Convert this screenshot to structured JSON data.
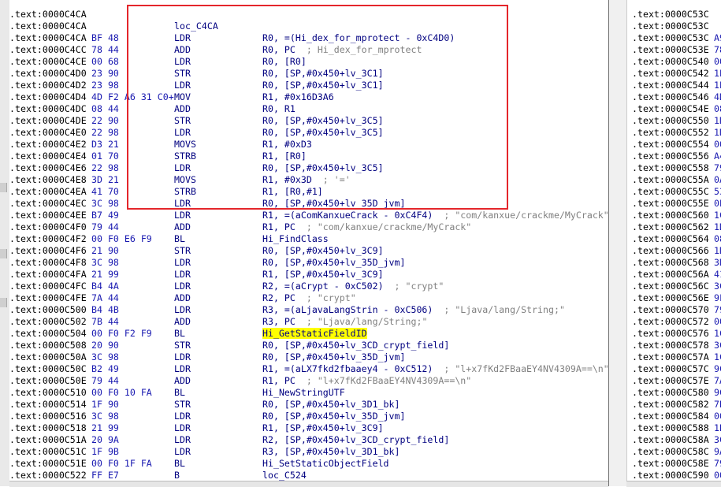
{
  "left_listing": [
    {
      "addr": ".text:0000C4CA",
      "bytes": "",
      "label": "",
      "mnem": "",
      "ops": "",
      "cmt": ""
    },
    {
      "addr": ".text:0000C4CA",
      "bytes": "",
      "label": "loc_C4CA",
      "mnem": "",
      "ops": "",
      "cmt": ""
    },
    {
      "addr": ".text:0000C4CA",
      "bytes": "BF 48",
      "label": "",
      "mnem": "LDR",
      "ops": "R0, =(Hi_dex_for_mprotect - 0xC4D0)",
      "cmt": ""
    },
    {
      "addr": ".text:0000C4CC",
      "bytes": "78 44",
      "label": "",
      "mnem": "ADD",
      "ops": "R0, PC",
      "cmt": "; Hi_dex_for_mprotect"
    },
    {
      "addr": ".text:0000C4CE",
      "bytes": "00 68",
      "label": "",
      "mnem": "LDR",
      "ops": "R0, [R0]",
      "cmt": ""
    },
    {
      "addr": ".text:0000C4D0",
      "bytes": "23 90",
      "label": "",
      "mnem": "STR",
      "ops": "R0, [SP,#0x450+lv_3C1]",
      "cmt": ""
    },
    {
      "addr": ".text:0000C4D2",
      "bytes": "23 98",
      "label": "",
      "mnem": "LDR",
      "ops": "R0, [SP,#0x450+lv_3C1]",
      "cmt": ""
    },
    {
      "addr": ".text:0000C4D4",
      "bytes": "4D F2 A6 31 C0+",
      "label": "",
      "mnem": "MOV",
      "ops": "R1, #0x16D3A6",
      "cmt": ""
    },
    {
      "addr": ".text:0000C4DC",
      "bytes": "08 44",
      "label": "",
      "mnem": "ADD",
      "ops": "R0, R1",
      "cmt": ""
    },
    {
      "addr": ".text:0000C4DE",
      "bytes": "22 90",
      "label": "",
      "mnem": "STR",
      "ops": "R0, [SP,#0x450+lv_3C5]",
      "cmt": ""
    },
    {
      "addr": ".text:0000C4E0",
      "bytes": "22 98",
      "label": "",
      "mnem": "LDR",
      "ops": "R0, [SP,#0x450+lv_3C5]",
      "cmt": ""
    },
    {
      "addr": ".text:0000C4E2",
      "bytes": "D3 21",
      "label": "",
      "mnem": "MOVS",
      "ops": "R1, #0xD3",
      "cmt": ""
    },
    {
      "addr": ".text:0000C4E4",
      "bytes": "01 70",
      "label": "",
      "mnem": "STRB",
      "ops": "R1, [R0]",
      "cmt": ""
    },
    {
      "addr": ".text:0000C4E6",
      "bytes": "22 98",
      "label": "",
      "mnem": "LDR",
      "ops": "R0, [SP,#0x450+lv_3C5]",
      "cmt": ""
    },
    {
      "addr": ".text:0000C4E8",
      "bytes": "3D 21",
      "label": "",
      "mnem": "MOVS",
      "ops": "R1, #0x3D",
      "cmt": "; '='"
    },
    {
      "addr": ".text:0000C4EA",
      "bytes": "41 70",
      "label": "",
      "mnem": "STRB",
      "ops": "R1, [R0,#1]",
      "cmt": ""
    },
    {
      "addr": ".text:0000C4EC",
      "bytes": "3C 98",
      "label": "",
      "mnem": "LDR",
      "ops": "R0, [SP,#0x450+lv_35D_jvm]",
      "cmt": ""
    },
    {
      "addr": ".text:0000C4EE",
      "bytes": "B7 49",
      "label": "",
      "mnem": "LDR",
      "ops": "R1, =(aComKanxueCrack - 0xC4F4)",
      "cmt": "; \"com/kanxue/crackme/MyCrack\""
    },
    {
      "addr": ".text:0000C4F0",
      "bytes": "79 44",
      "label": "",
      "mnem": "ADD",
      "ops": "R1, PC",
      "cmt": "; \"com/kanxue/crackme/MyCrack\""
    },
    {
      "addr": ".text:0000C4F2",
      "bytes": "00 F0 E6 F9",
      "label": "",
      "mnem": "BL",
      "ops": "Hi_FindClass",
      "cmt": ""
    },
    {
      "addr": ".text:0000C4F6",
      "bytes": "21 90",
      "label": "",
      "mnem": "STR",
      "ops": "R0, [SP,#0x450+lv_3C9]",
      "cmt": ""
    },
    {
      "addr": ".text:0000C4F8",
      "bytes": "3C 98",
      "label": "",
      "mnem": "LDR",
      "ops": "R0, [SP,#0x450+lv_35D_jvm]",
      "cmt": ""
    },
    {
      "addr": ".text:0000C4FA",
      "bytes": "21 99",
      "label": "",
      "mnem": "LDR",
      "ops": "R1, [SP,#0x450+lv_3C9]",
      "cmt": ""
    },
    {
      "addr": ".text:0000C4FC",
      "bytes": "B4 4A",
      "label": "",
      "mnem": "LDR",
      "ops": "R2, =(aCrypt - 0xC502)",
      "cmt": "; \"crypt\""
    },
    {
      "addr": ".text:0000C4FE",
      "bytes": "7A 44",
      "label": "",
      "mnem": "ADD",
      "ops": "R2, PC",
      "cmt": "; \"crypt\""
    },
    {
      "addr": ".text:0000C500",
      "bytes": "B4 4B",
      "label": "",
      "mnem": "LDR",
      "ops": "R3, =(aLjavaLangStrin - 0xC506)",
      "cmt": "; \"Ljava/lang/String;\""
    },
    {
      "addr": ".text:0000C502",
      "bytes": "7B 44",
      "label": "",
      "mnem": "ADD",
      "ops": "R3, PC",
      "cmt": "; \"Ljava/lang/String;\""
    },
    {
      "addr": ".text:0000C504",
      "bytes": "00 F0 F2 F9",
      "label": "",
      "mnem": "BL",
      "ops": "Hi_GetStaticFieldID",
      "cmt": "",
      "hl": true
    },
    {
      "addr": ".text:0000C508",
      "bytes": "20 90",
      "label": "",
      "mnem": "STR",
      "ops": "R0, [SP,#0x450+lv_3CD_crypt_field]",
      "cmt": ""
    },
    {
      "addr": ".text:0000C50A",
      "bytes": "3C 98",
      "label": "",
      "mnem": "LDR",
      "ops": "R0, [SP,#0x450+lv_35D_jvm]",
      "cmt": ""
    },
    {
      "addr": ".text:0000C50C",
      "bytes": "B2 49",
      "label": "",
      "mnem": "LDR",
      "ops": "R1, =(aLX7fkd2fbaaey4 - 0xC512)",
      "cmt": "; \"l+x7fKd2FBaaEY4NV4309A==\\n\""
    },
    {
      "addr": ".text:0000C50E",
      "bytes": "79 44",
      "label": "",
      "mnem": "ADD",
      "ops": "R1, PC",
      "cmt": "; \"l+x7fKd2FBaaEY4NV4309A==\\n\""
    },
    {
      "addr": ".text:0000C510",
      "bytes": "00 F0 10 FA",
      "label": "",
      "mnem": "BL",
      "ops": "Hi_NewStringUTF",
      "cmt": ""
    },
    {
      "addr": ".text:0000C514",
      "bytes": "1F 90",
      "label": "",
      "mnem": "STR",
      "ops": "R0, [SP,#0x450+lv_3D1_bk]",
      "cmt": ""
    },
    {
      "addr": ".text:0000C516",
      "bytes": "3C 98",
      "label": "",
      "mnem": "LDR",
      "ops": "R0, [SP,#0x450+lv_35D_jvm]",
      "cmt": ""
    },
    {
      "addr": ".text:0000C518",
      "bytes": "21 99",
      "label": "",
      "mnem": "LDR",
      "ops": "R1, [SP,#0x450+lv_3C9]",
      "cmt": ""
    },
    {
      "addr": ".text:0000C51A",
      "bytes": "20 9A",
      "label": "",
      "mnem": "LDR",
      "ops": "R2, [SP,#0x450+lv_3CD_crypt_field]",
      "cmt": ""
    },
    {
      "addr": ".text:0000C51C",
      "bytes": "1F 9B",
      "label": "",
      "mnem": "LDR",
      "ops": "R3, [SP,#0x450+lv_3D1_bk]",
      "cmt": ""
    },
    {
      "addr": ".text:0000C51E",
      "bytes": "00 F0 1F FA",
      "label": "",
      "mnem": "BL",
      "ops": "Hi_SetStaticObjectField",
      "cmt": ""
    },
    {
      "addr": ".text:0000C522",
      "bytes": "FF E7",
      "label": "",
      "mnem": "B",
      "ops": "loc_C524",
      "cmt": ""
    }
  ],
  "right_listing": [
    {
      "addr": ".text:0000C53C",
      "bytes": ""
    },
    {
      "addr": ".text:0000C53C",
      "bytes": ""
    },
    {
      "addr": ".text:0000C53C",
      "bytes": "A9"
    },
    {
      "addr": ".text:0000C53E",
      "bytes": "78"
    },
    {
      "addr": ".text:0000C540",
      "bytes": "00"
    },
    {
      "addr": ".text:0000C542",
      "bytes": "1E"
    },
    {
      "addr": ".text:0000C544",
      "bytes": "1E"
    },
    {
      "addr": ".text:0000C546",
      "bytes": "4D"
    },
    {
      "addr": ".text:0000C54E",
      "bytes": "08"
    },
    {
      "addr": ".text:0000C550",
      "bytes": "1D"
    },
    {
      "addr": ".text:0000C552",
      "bytes": "1D"
    },
    {
      "addr": ".text:0000C554",
      "bytes": "00"
    },
    {
      "addr": ".text:0000C556",
      "bytes": "A4"
    },
    {
      "addr": ".text:0000C558",
      "bytes": "79"
    },
    {
      "addr": ".text:0000C55A",
      "bytes": "0A"
    },
    {
      "addr": ".text:0000C55C",
      "bytes": "53"
    },
    {
      "addr": ".text:0000C55E",
      "bytes": "0E"
    },
    {
      "addr": ".text:0000C560",
      "bytes": "1C"
    },
    {
      "addr": ".text:0000C562",
      "bytes": "1D"
    },
    {
      "addr": ".text:0000C564",
      "bytes": "08"
    },
    {
      "addr": ".text:0000C566",
      "bytes": "1D"
    },
    {
      "addr": ".text:0000C568",
      "bytes": "3D"
    },
    {
      "addr": ".text:0000C56A",
      "bytes": "41"
    },
    {
      "addr": ".text:0000C56C",
      "bytes": "3C"
    },
    {
      "addr": ".text:0000C56E",
      "bytes": "9F"
    },
    {
      "addr": ".text:0000C570",
      "bytes": "79"
    },
    {
      "addr": ".text:0000C572",
      "bytes": "00"
    },
    {
      "addr": ".text:0000C576",
      "bytes": "1C"
    },
    {
      "addr": ".text:0000C578",
      "bytes": "3C"
    },
    {
      "addr": ".text:0000C57A",
      "bytes": "1C"
    },
    {
      "addr": ".text:0000C57C",
      "bytes": "9C"
    },
    {
      "addr": ".text:0000C57E",
      "bytes": "7A"
    },
    {
      "addr": ".text:0000C580",
      "bytes": "9C"
    },
    {
      "addr": ".text:0000C582",
      "bytes": "7B"
    },
    {
      "addr": ".text:0000C584",
      "bytes": "00"
    },
    {
      "addr": ".text:0000C588",
      "bytes": "1B"
    },
    {
      "addr": ".text:0000C58A",
      "bytes": "3C"
    },
    {
      "addr": ".text:0000C58C",
      "bytes": "9A"
    },
    {
      "addr": ".text:0000C58E",
      "bytes": "79"
    },
    {
      "addr": ".text:0000C590",
      "bytes": "00"
    }
  ]
}
